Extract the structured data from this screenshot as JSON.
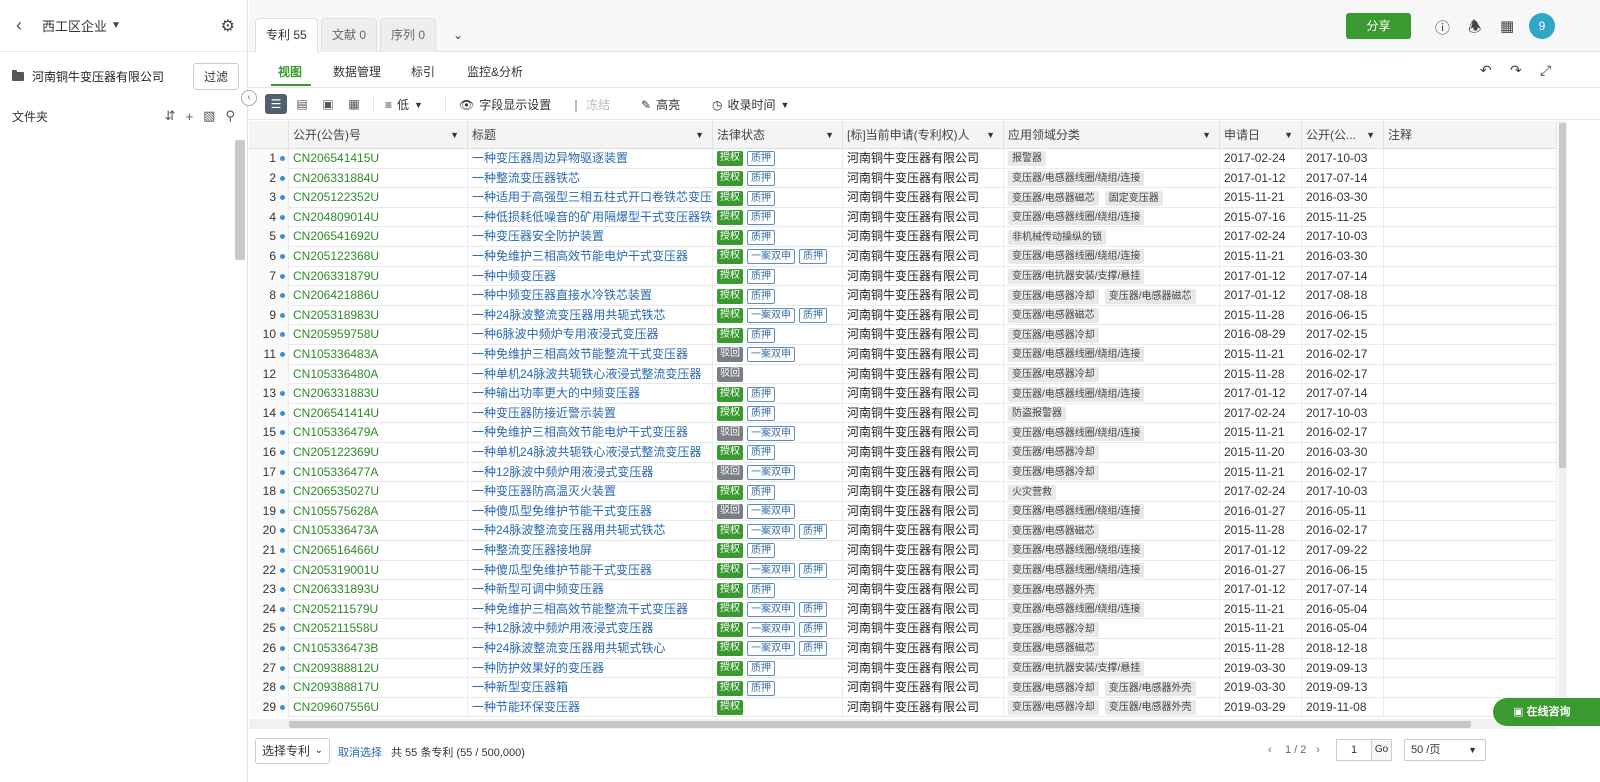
{
  "sidebar": {
    "workspace": "西工区企业",
    "company": "河南铜牛变压器有限公司",
    "filter_label": "过滤",
    "folder_label": "文件夹"
  },
  "tabs": [
    {
      "label": "专利 55",
      "active": true
    },
    {
      "label": "文献 0",
      "active": false
    },
    {
      "label": "序列 0",
      "active": false
    }
  ],
  "header": {
    "share_label": "分享",
    "avatar_text": "9"
  },
  "subtabs": [
    "视图",
    "数据管理",
    "标引",
    "监控&分析"
  ],
  "toolbar": {
    "sort_label": "低",
    "fields_label": "字段显示设置",
    "freeze_label": "冻结",
    "highlight_label": "高亮",
    "time_label": "收录时间"
  },
  "columns": [
    "公开(公告)号",
    "标题",
    "法律状态",
    "[标]当前申请(专利权)人",
    "应用领域分类",
    "申请日",
    "公开(公...",
    "注释"
  ],
  "rows": [
    {
      "idx": "1",
      "num": "CN206541415U",
      "title": "一种变压器周边异物驱逐装置",
      "status": [
        "授权",
        "质押"
      ],
      "owner": "河南铜牛变压器有限公司",
      "tags": [
        "报警器"
      ],
      "apply": "2017-02-24",
      "pub": "2017-10-03",
      "dot": true
    },
    {
      "idx": "2",
      "num": "CN206331884U",
      "title": "一种整流变压器铁芯",
      "status": [
        "授权",
        "质押"
      ],
      "owner": "河南铜牛变压器有限公司",
      "tags": [
        "变压器/电感器线圈/绕组/连接"
      ],
      "apply": "2017-01-12",
      "pub": "2017-07-14",
      "dot": true
    },
    {
      "idx": "3",
      "num": "CN205122352U",
      "title": "一种适用于高强型三相五柱式开口卷铁芯变压",
      "status": [
        "授权",
        "质押"
      ],
      "owner": "河南铜牛变压器有限公司",
      "tags": [
        "变压器/电感器磁芯",
        "固定变压器"
      ],
      "apply": "2015-11-21",
      "pub": "2016-03-30",
      "dot": true
    },
    {
      "idx": "4",
      "num": "CN204809014U",
      "title": "一种低损耗低噪音的矿用隔爆型干式变压器铁",
      "status": [
        "授权",
        "质押"
      ],
      "owner": "河南铜牛变压器有限公司",
      "tags": [
        "变压器/电感器线圈/绕组/连接"
      ],
      "apply": "2015-07-16",
      "pub": "2015-11-25",
      "dot": true
    },
    {
      "idx": "5",
      "num": "CN206541692U",
      "title": "一种变压器安全防护装置",
      "status": [
        "授权",
        "质押"
      ],
      "owner": "河南铜牛变压器有限公司",
      "tags": [
        "非机械传动操纵的锁"
      ],
      "apply": "2017-02-24",
      "pub": "2017-10-03",
      "dot": true
    },
    {
      "idx": "6",
      "num": "CN205122368U",
      "title": "一种免维护三相高效节能电炉干式变压器",
      "status": [
        "授权",
        "一案双申",
        "质押"
      ],
      "owner": "河南铜牛变压器有限公司",
      "tags": [
        "变压器/电感器线圈/绕组/连接"
      ],
      "apply": "2015-11-21",
      "pub": "2016-03-30",
      "dot": true
    },
    {
      "idx": "7",
      "num": "CN206331879U",
      "title": "一种中频变压器",
      "status": [
        "授权",
        "质押"
      ],
      "owner": "河南铜牛变压器有限公司",
      "tags": [
        "变压器/电抗器安装/支撑/悬挂"
      ],
      "apply": "2017-01-12",
      "pub": "2017-07-14",
      "dot": true
    },
    {
      "idx": "8",
      "num": "CN206421886U",
      "title": "一种中频变压器直接水冷铁芯装置",
      "status": [
        "授权",
        "质押"
      ],
      "owner": "河南铜牛变压器有限公司",
      "tags": [
        "变压器/电感器冷却",
        "变压器/电感器磁芯"
      ],
      "apply": "2017-01-12",
      "pub": "2017-08-18",
      "dot": true
    },
    {
      "idx": "9",
      "num": "CN205318983U",
      "title": "一种24脉波整流变压器用共轭式铁芯",
      "status": [
        "授权",
        "一案双申",
        "质押"
      ],
      "owner": "河南铜牛变压器有限公司",
      "tags": [
        "变压器/电感器磁芯"
      ],
      "apply": "2015-11-28",
      "pub": "2016-06-15",
      "dot": true
    },
    {
      "idx": "10",
      "num": "CN205959758U",
      "title": "一种6脉波中频炉专用液浸式变压器",
      "status": [
        "授权",
        "质押"
      ],
      "owner": "河南铜牛变压器有限公司",
      "tags": [
        "变压器/电感器冷却"
      ],
      "apply": "2016-08-29",
      "pub": "2017-02-15",
      "dot": true
    },
    {
      "idx": "11",
      "num": "CN105336483A",
      "title": "一种免维护三相高效节能整流干式变压器",
      "status": [
        "驳回",
        "一案双申"
      ],
      "owner": "河南铜牛变压器有限公司",
      "tags": [
        "变压器/电感器线圈/绕组/连接"
      ],
      "apply": "2015-11-21",
      "pub": "2016-02-17",
      "dot": true
    },
    {
      "idx": "12",
      "num": "CN105336480A",
      "title": "一种单机24脉波共轭铁心液浸式整流变压器",
      "status": [
        "驳回"
      ],
      "owner": "河南铜牛变压器有限公司",
      "tags": [
        "变压器/电感器冷却"
      ],
      "apply": "2015-11-28",
      "pub": "2016-02-17",
      "dot": false
    },
    {
      "idx": "13",
      "num": "CN206331883U",
      "title": "一种输出功率更大的中频变压器",
      "status": [
        "授权",
        "质押"
      ],
      "owner": "河南铜牛变压器有限公司",
      "tags": [
        "变压器/电感器线圈/绕组/连接"
      ],
      "apply": "2017-01-12",
      "pub": "2017-07-14",
      "dot": true
    },
    {
      "idx": "14",
      "num": "CN206541414U",
      "title": "一种变压器防接近警示装置",
      "status": [
        "授权",
        "质押"
      ],
      "owner": "河南铜牛变压器有限公司",
      "tags": [
        "防盗报警器"
      ],
      "apply": "2017-02-24",
      "pub": "2017-10-03",
      "dot": true
    },
    {
      "idx": "15",
      "num": "CN105336479A",
      "title": "一种免维护三相高效节能电炉干式变压器",
      "status": [
        "驳回",
        "一案双申"
      ],
      "owner": "河南铜牛变压器有限公司",
      "tags": [
        "变压器/电感器线圈/绕组/连接"
      ],
      "apply": "2015-11-21",
      "pub": "2016-02-17",
      "dot": true
    },
    {
      "idx": "16",
      "num": "CN205122369U",
      "title": "一种单机24脉波共轭铁心液浸式整流变压器",
      "status": [
        "授权",
        "质押"
      ],
      "owner": "河南铜牛变压器有限公司",
      "tags": [
        "变压器/电感器冷却"
      ],
      "apply": "2015-11-20",
      "pub": "2016-03-30",
      "dot": true
    },
    {
      "idx": "17",
      "num": "CN105336477A",
      "title": "一种12脉波中频炉用液浸式变压器",
      "status": [
        "驳回",
        "一案双申"
      ],
      "owner": "河南铜牛变压器有限公司",
      "tags": [
        "变压器/电感器冷却"
      ],
      "apply": "2015-11-21",
      "pub": "2016-02-17",
      "dot": true
    },
    {
      "idx": "18",
      "num": "CN206535027U",
      "title": "一种变压器防高温灭火装置",
      "status": [
        "授权",
        "质押"
      ],
      "owner": "河南铜牛变压器有限公司",
      "tags": [
        "火灾营救"
      ],
      "apply": "2017-02-24",
      "pub": "2017-10-03",
      "dot": true
    },
    {
      "idx": "19",
      "num": "CN105575628A",
      "title": "一种傻瓜型免维护节能干式变压器",
      "status": [
        "驳回",
        "一案双申"
      ],
      "owner": "河南铜牛变压器有限公司",
      "tags": [
        "变压器/电感器线圈/绕组/连接"
      ],
      "apply": "2016-01-27",
      "pub": "2016-05-11",
      "dot": true
    },
    {
      "idx": "20",
      "num": "CN105336473A",
      "title": "一种24脉波整流变压器用共轭式铁芯",
      "status": [
        "授权",
        "一案双申",
        "质押"
      ],
      "owner": "河南铜牛变压器有限公司",
      "tags": [
        "变压器/电感器磁芯"
      ],
      "apply": "2015-11-28",
      "pub": "2016-02-17",
      "dot": true
    },
    {
      "idx": "21",
      "num": "CN206516466U",
      "title": "一种整流变压器接地屏",
      "status": [
        "授权",
        "质押"
      ],
      "owner": "河南铜牛变压器有限公司",
      "tags": [
        "变压器/电感器线圈/绕组/连接"
      ],
      "apply": "2017-01-12",
      "pub": "2017-09-22",
      "dot": true
    },
    {
      "idx": "22",
      "num": "CN205319001U",
      "title": "一种傻瓜型免维护节能干式变压器",
      "status": [
        "授权",
        "一案双申",
        "质押"
      ],
      "owner": "河南铜牛变压器有限公司",
      "tags": [
        "变压器/电感器线圈/绕组/连接"
      ],
      "apply": "2016-01-27",
      "pub": "2016-06-15",
      "dot": true
    },
    {
      "idx": "23",
      "num": "CN206331893U",
      "title": "一种新型可调中频变压器",
      "status": [
        "授权",
        "质押"
      ],
      "owner": "河南铜牛变压器有限公司",
      "tags": [
        "变压器/电感器外壳"
      ],
      "apply": "2017-01-12",
      "pub": "2017-07-14",
      "dot": true
    },
    {
      "idx": "24",
      "num": "CN205211579U",
      "title": "一种免维护三相高效节能整流干式变压器",
      "status": [
        "授权",
        "一案双申",
        "质押"
      ],
      "owner": "河南铜牛变压器有限公司",
      "tags": [
        "变压器/电感器线圈/绕组/连接"
      ],
      "apply": "2015-11-21",
      "pub": "2016-05-04",
      "dot": true
    },
    {
      "idx": "25",
      "num": "CN205211558U",
      "title": "一种12脉波中频炉用液浸式变压器",
      "status": [
        "授权",
        "一案双申",
        "质押"
      ],
      "owner": "河南铜牛变压器有限公司",
      "tags": [
        "变压器/电感器冷却"
      ],
      "apply": "2015-11-21",
      "pub": "2016-05-04",
      "dot": true
    },
    {
      "idx": "26",
      "num": "CN105336473B",
      "title": "一种24脉波整流变压器用共轭式铁心",
      "status": [
        "授权",
        "一案双申",
        "质押"
      ],
      "owner": "河南铜牛变压器有限公司",
      "tags": [
        "变压器/电感器磁芯"
      ],
      "apply": "2015-11-28",
      "pub": "2018-12-18",
      "dot": true
    },
    {
      "idx": "27",
      "num": "CN209388812U",
      "title": "一种防护效果好的变压器",
      "status": [
        "授权",
        "质押"
      ],
      "owner": "河南铜牛变压器有限公司",
      "tags": [
        "变压器/电抗器安装/支撑/悬挂"
      ],
      "apply": "2019-03-30",
      "pub": "2019-09-13",
      "dot": true
    },
    {
      "idx": "28",
      "num": "CN209388817U",
      "title": "一种新型变压器箱",
      "status": [
        "授权",
        "质押"
      ],
      "owner": "河南铜牛变压器有限公司",
      "tags": [
        "变压器/电感器冷却",
        "变压器/电感器外壳"
      ],
      "apply": "2019-03-30",
      "pub": "2019-09-13",
      "dot": true
    },
    {
      "idx": "29",
      "num": "CN209607556U",
      "title": "一种节能环保变压器",
      "status": [
        "授权"
      ],
      "owner": "河南铜牛变压器有限公司",
      "tags": [
        "变压器/电感器冷却",
        "变压器/电感器外壳"
      ],
      "apply": "2019-03-29",
      "pub": "2019-11-08",
      "dot": true
    }
  ],
  "footer": {
    "select_label": "选择专利",
    "cancel_label": "取消选择",
    "count_text": "共 55 条专利 (55 / 500,000)",
    "page_info": "1 / 2",
    "page_input": "1",
    "go_label": "Go",
    "page_size": "50 /页"
  },
  "chat_label": "在线咨询"
}
